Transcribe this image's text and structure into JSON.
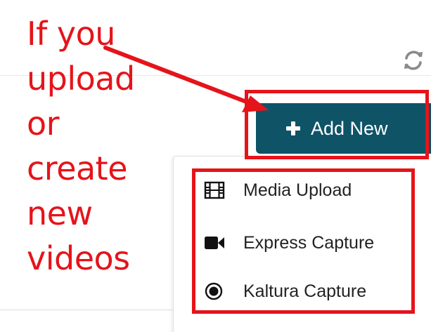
{
  "annotation": {
    "text": "If you\nupload\nor\ncreate\nnew\nvideos",
    "color": "#e5141a"
  },
  "toolbar": {
    "refresh_icon": "refresh-icon"
  },
  "add_button": {
    "label": "Add New",
    "icon": "plus-icon",
    "color": "#0f5367"
  },
  "menu": {
    "items": [
      {
        "label": "Media Upload",
        "icon": "film-icon"
      },
      {
        "label": "Express Capture",
        "icon": "video-camera-icon"
      },
      {
        "label": "Kaltura Capture",
        "icon": "record-circle-icon"
      }
    ]
  }
}
